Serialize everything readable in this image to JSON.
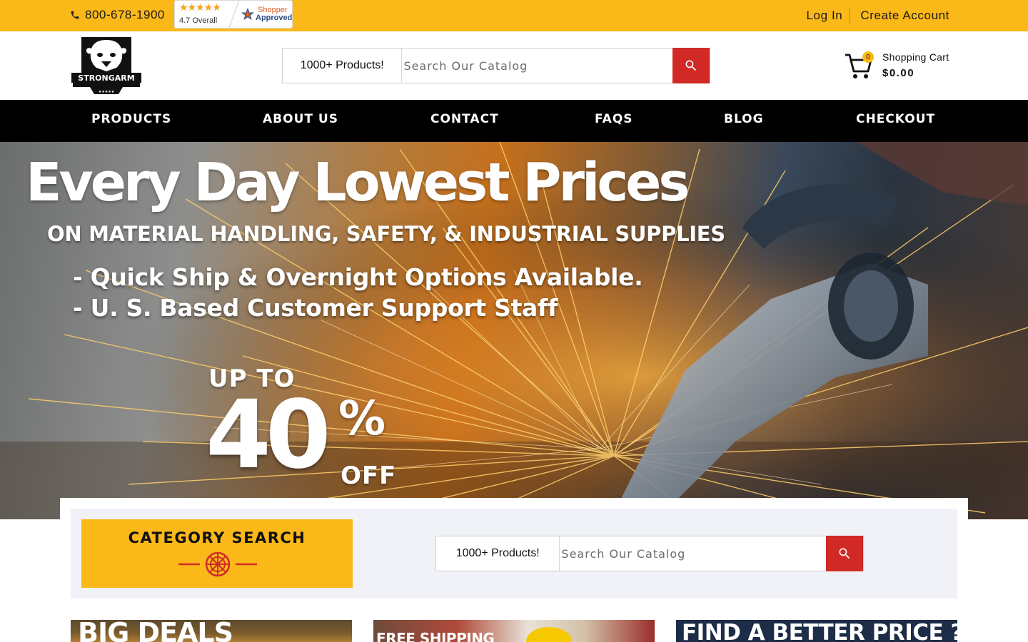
{
  "topbar": {
    "phone": "800-678-1900",
    "rating_stars": "★★★★★",
    "rating_text": "4.7 Overall",
    "shopper_line1": "Shopper",
    "shopper_line2": "Approved",
    "login": "Log In",
    "create_account": "Create Account"
  },
  "header": {
    "logo_text": "STRONGARM",
    "search": {
      "prefix": "1000+ Products!",
      "placeholder": "Search Our Catalog"
    },
    "cart": {
      "count": "0",
      "label": "Shopping Cart",
      "total": "$0.00"
    }
  },
  "nav": {
    "items": [
      "PRODUCTS",
      "ABOUT US",
      "CONTACT",
      "FAQS",
      "BLOG",
      "CHECKOUT"
    ]
  },
  "hero": {
    "headline": "Every Day Lowest Prices",
    "subheadline": "ON MATERIAL HANDLING, SAFETY, & INDUSTRIAL SUPPLIES",
    "bullets": [
      "- Quick Ship & Overnight Options Available.",
      "- U. S. Based Customer Support Staff"
    ],
    "upto": "UP TO",
    "discount": "40",
    "percent": "%",
    "off": "OFF"
  },
  "category": {
    "title": "CATEGORY SEARCH",
    "search": {
      "prefix": "1000+ Products!",
      "placeholder": "Search Our Catalog"
    }
  },
  "promos": [
    "BIG DEALS",
    "FREE SHIPPING",
    "FIND A BETTER PRICE ?"
  ],
  "colors": {
    "accent": "#fbb919",
    "search_button": "#d12a26",
    "nav_bg": "#000000"
  }
}
